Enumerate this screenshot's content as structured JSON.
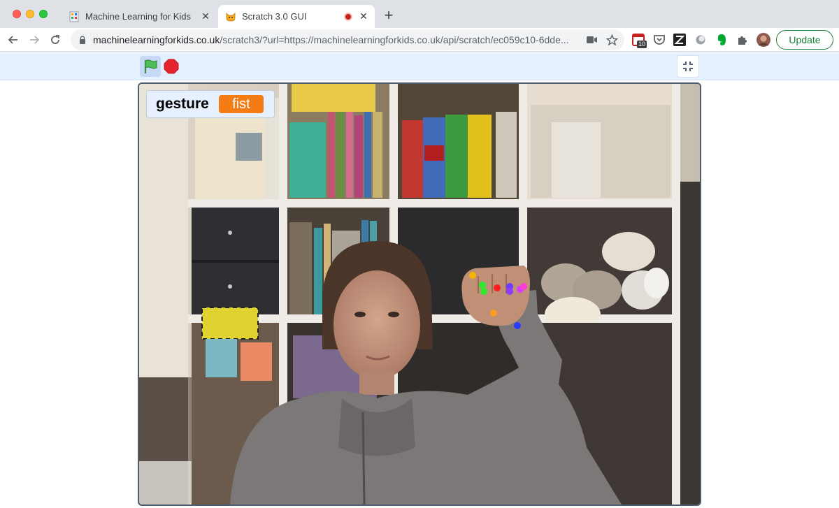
{
  "browser": {
    "tabs": [
      {
        "title": "Machine Learning for Kids",
        "active": false,
        "favicon": "mlforkids-favicon"
      },
      {
        "title": "Scratch 3.0 GUI",
        "active": true,
        "favicon": "scratch-cat-favicon",
        "recording": true
      }
    ],
    "address": {
      "host": "machinelearningforkids.co.uk",
      "path": "/scratch3/?url=https://machinelearningforkids.co.uk/api/scratch/ec059c10-6dde..."
    },
    "extensions": {
      "badge_count": "10"
    },
    "update_label": "Update"
  },
  "player": {
    "controls": [
      "green-flag",
      "stop-sign",
      "unfullscreen"
    ]
  },
  "stage": {
    "monitor": {
      "label": "gesture",
      "value": "fist"
    },
    "keypoint_colors": [
      "#f6b400",
      "#2ee82e",
      "#ff1e1e",
      "#6b3cff",
      "#d63cff",
      "#ff9a1e",
      "#2a3cff"
    ]
  },
  "colors": {
    "monitor_value_bg": "#f37d14",
    "update_green": "#188038",
    "stop_red": "#e6242d",
    "flag_green": "#4cbf56"
  }
}
